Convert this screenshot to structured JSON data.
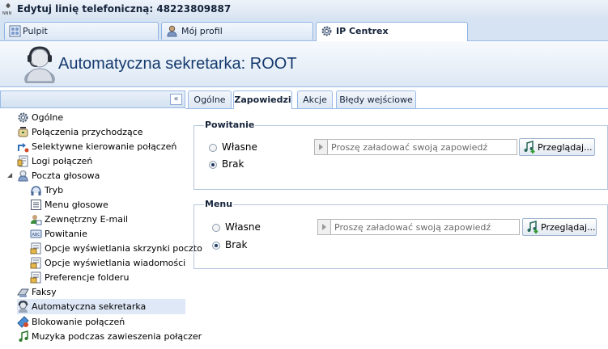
{
  "window": {
    "title": "Edytuj linię telefoniczną: 48223809887",
    "app_icon": "nnn-logo-icon"
  },
  "top_tabs": [
    {
      "label": "Pulpit",
      "icon": "dashboard-icon"
    },
    {
      "label": "Mój profil",
      "icon": "user-profile-icon"
    },
    {
      "label": "IP Centrex",
      "icon": "gear-icon",
      "active": true
    }
  ],
  "header": {
    "title": "Automatyczna sekretarka: ROOT",
    "icon": "operator-headset-icon"
  },
  "sidebar": {
    "collapse_label": "«",
    "items": [
      {
        "label": "Ogólne",
        "icon": "gear-icon"
      },
      {
        "label": "Połączenia przychodzące",
        "icon": "incoming-calls-icon"
      },
      {
        "label": "Selektywne kierowanie połączeń",
        "icon": "routing-icon"
      },
      {
        "label": "Logi połączeń",
        "icon": "log-icon"
      },
      {
        "label": "Poczta głosowa",
        "icon": "voicemail-icon"
      },
      {
        "label": "Tryb",
        "icon": "mode-icon"
      },
      {
        "label": "Menu głosowe",
        "icon": "menu-icon"
      },
      {
        "label": "Zewnętrzny E-mail",
        "icon": "email-icon"
      },
      {
        "label": "Powitanie",
        "icon": "greeting-icon"
      },
      {
        "label": "Opcje wyświetlania skrzynki poczto",
        "icon": "mailbox-options-icon"
      },
      {
        "label": "Opcje wyświetlania wiadomości",
        "icon": "message-options-icon"
      },
      {
        "label": "Preferencje folderu",
        "icon": "folder-prefs-icon"
      },
      {
        "label": "Faksy",
        "icon": "fax-icon"
      },
      {
        "label": "Automatyczna sekretarka",
        "icon": "auto-attendant-icon",
        "selected": true
      },
      {
        "label": "Blokowanie połączeń",
        "icon": "call-block-icon"
      },
      {
        "label": "Muzyka podczas zawieszenia połączer",
        "icon": "music-icon"
      }
    ]
  },
  "content_tabs": [
    {
      "label": "Ogólne"
    },
    {
      "label": "Zapowiedzi",
      "active": true
    },
    {
      "label": "Akcje"
    },
    {
      "label": "Błędy wejściowe"
    }
  ],
  "sections": {
    "powitanie": {
      "legend": "Powitanie",
      "option_custom": "Własne",
      "option_none": "Brak",
      "selected": "Brak",
      "file_placeholder": "Proszę załadować swoją zapowiedź",
      "browse_label": "Przeglądaj..."
    },
    "menu": {
      "legend": "Menu",
      "option_custom": "Własne",
      "option_none": "Brak",
      "selected": "Brak",
      "file_placeholder": "Proszę załadować swoją zapowiedź",
      "browse_label": "Przeglądaj..."
    }
  },
  "colors": {
    "accent": "#153a6e",
    "border": "#99bbe8",
    "selection": "#dfe8f6"
  }
}
